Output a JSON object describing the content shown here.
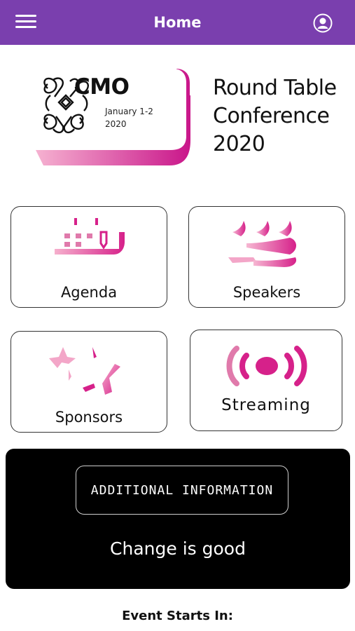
{
  "header": {
    "title": "Home",
    "menu_icon": "hamburger-menu-icon",
    "profile_icon": "user-circle-icon",
    "background": "#7a3fae"
  },
  "event": {
    "logo_icon": "knot-logo-icon",
    "brand": "CMO",
    "dates": "January 1-2",
    "year": "2020",
    "title_line1": "Round Table",
    "title_line2": "Conference",
    "title_line3": "2020"
  },
  "tiles": [
    {
      "label": "Agenda",
      "icon": "calendar-icon"
    },
    {
      "label": "Speakers",
      "icon": "speakers-icon"
    },
    {
      "label": "Sponsors",
      "icon": "star-icon"
    },
    {
      "label": "Streaming",
      "icon": "broadcast-icon"
    }
  ],
  "info": {
    "button_label": "ADDITIONAL INFORMATION",
    "tagline": "Change is good"
  },
  "countdown": {
    "label": "Event Starts In:"
  },
  "colors": {
    "accent_pink": "#e0328f",
    "accent_light": "#f3a6c8",
    "panel": "#000000"
  }
}
